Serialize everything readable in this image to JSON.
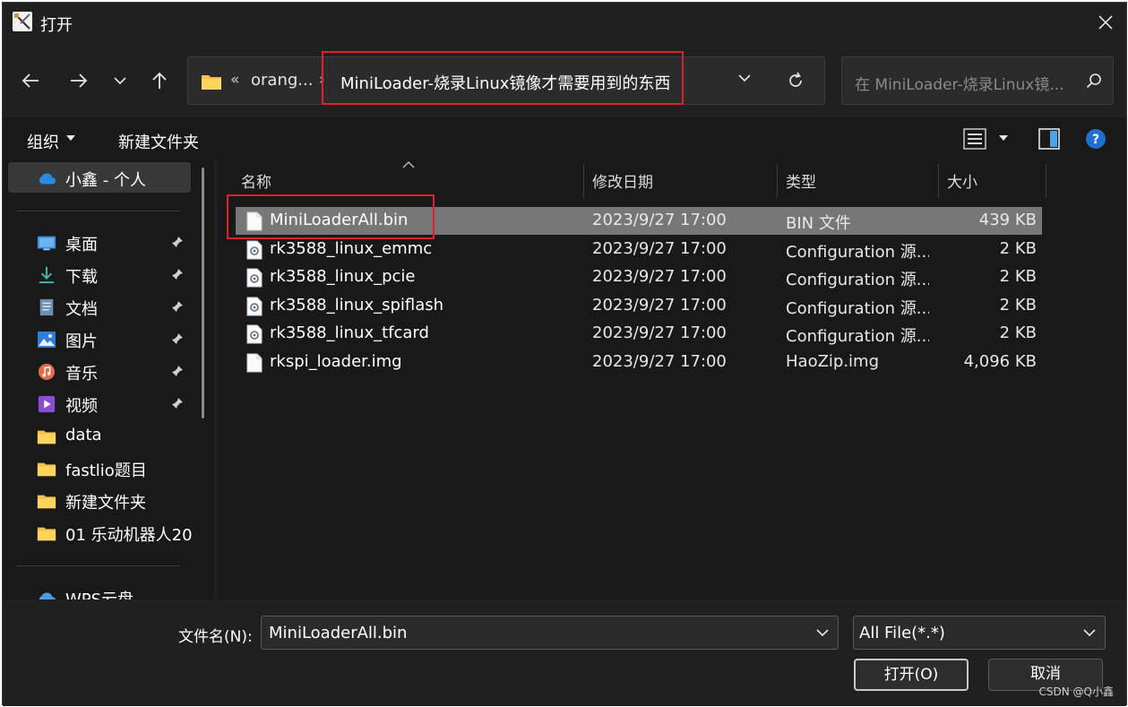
{
  "window": {
    "title": "打开",
    "close_icon": "close-icon"
  },
  "navigation": {
    "address_chevrons": "«",
    "breadcrumb_parent": "orang...",
    "breadcrumb_separator": "›",
    "breadcrumb_current": "MiniLoader-烧录Linux镜像才需要用到的东西",
    "search_placeholder": "在 MiniLoader-烧录Linux镜..."
  },
  "toolbar": {
    "organize_label": "组织",
    "new_folder_label": "新建文件夹"
  },
  "sidebar": {
    "items": [
      {
        "label": "小鑫 - 个人",
        "icon": "onedrive-cloud-icon",
        "pinned": false
      },
      {
        "label": "桌面",
        "icon": "desktop-icon",
        "pinned": true
      },
      {
        "label": "下载",
        "icon": "download-icon",
        "pinned": true
      },
      {
        "label": "文档",
        "icon": "document-icon",
        "pinned": true
      },
      {
        "label": "图片",
        "icon": "pictures-icon",
        "pinned": true
      },
      {
        "label": "音乐",
        "icon": "music-icon",
        "pinned": true
      },
      {
        "label": "视频",
        "icon": "video-icon",
        "pinned": true
      },
      {
        "label": "data",
        "icon": "folder-icon",
        "pinned": false
      },
      {
        "label": "fastlio题目",
        "icon": "folder-icon",
        "pinned": false
      },
      {
        "label": "新建文件夹",
        "icon": "folder-icon",
        "pinned": false
      },
      {
        "label": "01 乐动机器人20",
        "icon": "folder-icon",
        "pinned": false
      },
      {
        "label": "WPS云盘",
        "icon": "wps-cloud-icon",
        "pinned": false
      }
    ]
  },
  "file_list": {
    "columns": [
      "名称",
      "修改日期",
      "类型",
      "大小"
    ],
    "rows": [
      {
        "name": "MiniLoaderAll.bin",
        "date": "2023/9/27 17:00",
        "type": "BIN 文件",
        "size": "439 KB",
        "icon": "file-icon",
        "selected": true
      },
      {
        "name": "rk3588_linux_emmc",
        "date": "2023/9/27 17:00",
        "type": "Configuration 源...",
        "size": "2 KB",
        "icon": "config-file-icon",
        "selected": false
      },
      {
        "name": "rk3588_linux_pcie",
        "date": "2023/9/27 17:00",
        "type": "Configuration 源...",
        "size": "2 KB",
        "icon": "config-file-icon",
        "selected": false
      },
      {
        "name": "rk3588_linux_spiflash",
        "date": "2023/9/27 17:00",
        "type": "Configuration 源...",
        "size": "2 KB",
        "icon": "config-file-icon",
        "selected": false
      },
      {
        "name": "rk3588_linux_tfcard",
        "date": "2023/9/27 17:00",
        "type": "Configuration 源...",
        "size": "2 KB",
        "icon": "config-file-icon",
        "selected": false
      },
      {
        "name": "rkspi_loader.img",
        "date": "2023/9/27 17:00",
        "type": "HaoZip.img",
        "size": "4,096 KB",
        "icon": "file-icon",
        "selected": false
      }
    ]
  },
  "footer": {
    "filename_label": "文件名(N):",
    "filename_value": "MiniLoaderAll.bin",
    "filetype_value": "All File(*.*)",
    "open_button": "打开(O)",
    "cancel_button": "取消"
  },
  "watermark": "CSDN @Q小鑫",
  "colors": {
    "background": "#202020",
    "pane": "#191919",
    "selection": "#777777",
    "highlight_box": "#e0202a",
    "help_blue": "#1f6fd1",
    "folder_yellow": "#f4c04a"
  }
}
